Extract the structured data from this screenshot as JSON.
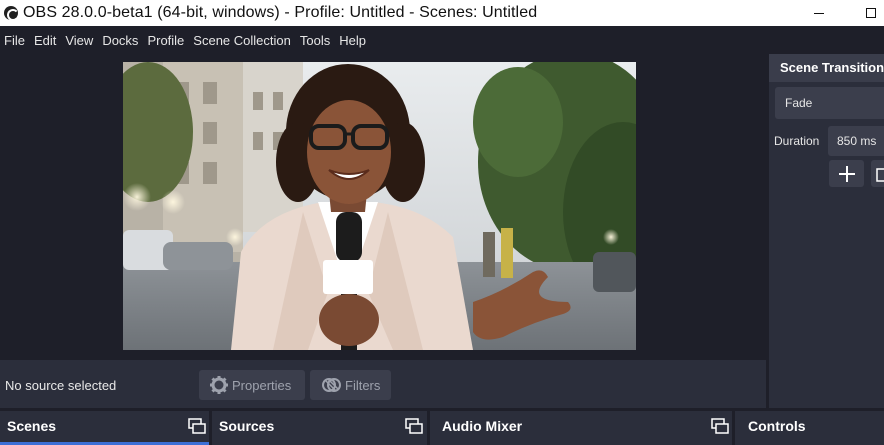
{
  "window": {
    "title": "OBS 28.0.0-beta1 (64-bit, windows) - Profile: Untitled - Scenes: Untitled"
  },
  "menu": [
    "File",
    "Edit",
    "View",
    "Docks",
    "Profile",
    "Scene Collection",
    "Tools",
    "Help"
  ],
  "preview": {
    "content": "camera-preview"
  },
  "source_bar": {
    "status": "No source selected",
    "properties_label": "Properties",
    "filters_label": "Filters"
  },
  "scene_transitions": {
    "title": "Scene Transitions",
    "transition": "Fade",
    "duration_label": "Duration",
    "duration_value": "850 ms"
  },
  "docks": {
    "scenes": "Scenes",
    "sources": "Sources",
    "audio_mixer": "Audio Mixer",
    "controls": "Controls"
  },
  "colors": {
    "background": "#1e1f29",
    "panel": "#2b2e3b",
    "button": "#3b3e4c",
    "accent": "#3c6fd6"
  }
}
